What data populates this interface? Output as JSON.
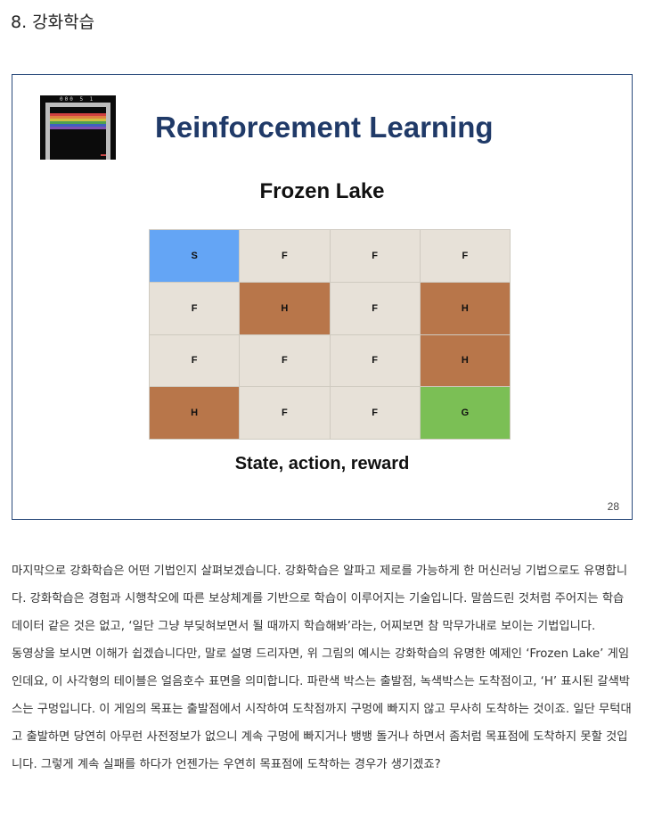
{
  "section_title": "8. 강화학습",
  "slide": {
    "title": "Reinforcement Learning",
    "game_title": "Frozen Lake",
    "caption": "State, action, reward",
    "page_number": "28",
    "thumbnail": {
      "score_text": "000 5 1",
      "band_colors": [
        "#d04040",
        "#e08040",
        "#d0c040",
        "#50a050",
        "#4060c0",
        "#8050b0"
      ]
    },
    "grid": {
      "colors": {
        "S": "#64a5f5",
        "F": "#e7e1d8",
        "H": "#b8764a",
        "G": "#7bbf55"
      },
      "rows": [
        [
          "S",
          "F",
          "F",
          "F"
        ],
        [
          "F",
          "H",
          "F",
          "H"
        ],
        [
          "F",
          "F",
          "F",
          "H"
        ],
        [
          "H",
          "F",
          "F",
          "G"
        ]
      ]
    }
  },
  "paragraphs": [
    "마지막으로 강화학습은 어떤 기법인지 살펴보겠습니다. 강화학습은 알파고 제로를 가능하게 한 머신러닝 기법으로도 유명합니다. 강화학습은 경험과 시행착오에 따른 보상체계를 기반으로 학습이 이루어지는 기술입니다. 말씀드린 것처럼 주어지는 학습 데이터 같은 것은 없고, ‘일단 그냥 부딪혀보면서 될 때까지 학습해봐’라는, 어찌보면 참 막무가내로 보이는 기법입니다.",
    "동영상을 보시면 이해가 쉽겠습니다만, 말로 설명 드리자면, 위 그림의 예시는 강화학습의 유명한 예제인 ‘Frozen Lake’ 게임인데요, 이 사각형의 테이블은 얼음호수 표면을 의미합니다. 파란색 박스는 출발점, 녹색박스는 도착점이고, ‘H’ 표시된 갈색박스는 구멍입니다. 이 게임의 목표는 출발점에서 시작하여 도착점까지 구멍에 빠지지 않고 무사히 도착하는 것이죠. 일단 무턱대고 출발하면 당연히 아무런 사전정보가 없으니 계속 구멍에 빠지거나 뱅뱅 돌거나 하면서 좀처럼 목표점에 도착하지 못할 것입니다. 그렇게 계속 실패를 하다가 언젠가는 우연히 목표점에 도착하는 경우가 생기겠죠?"
  ]
}
